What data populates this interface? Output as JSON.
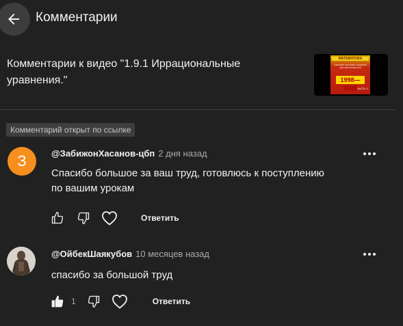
{
  "header": {
    "title": "Комментарии"
  },
  "video": {
    "context_line1": "Комментарии к видео \"1.9.1 Иррациональные",
    "context_line2": "уравнения.\"",
    "thumbnail": {
      "top_text": "МАТЕМАТИКА",
      "mid_text": "СБОРНИК ТЕСТОВЫХ ЗАДАНИЙ ДЛЯ АБИТУРИЕНТОВ",
      "years": "1998—2005",
      "part": "ЧАСТЬ 1"
    }
  },
  "badge": {
    "label": "Комментарий открыт по ссылке"
  },
  "comments": [
    {
      "avatar_letter": "З",
      "avatar_color": "#f68f1e",
      "author": "@ЗабижонХасанов-цбп",
      "time": "2 дня назад",
      "text_line1": "Спасибо большое за ваш труд, готовлюсь к поступлению",
      "text_line2": "по вашим урокам",
      "like_count": "",
      "reply_label": "Ответить"
    },
    {
      "avatar_letter": "",
      "author": "@ОйбекШаякубов",
      "time": "10 месяцев назад",
      "text_line1": "спасибо за большой труд",
      "text_line2": "",
      "like_count": "1",
      "reply_label": "Ответить"
    }
  ],
  "icons": {
    "back": "arrow-left-icon",
    "more": "more-horizontal-icon",
    "like": "thumb-up-icon",
    "dislike": "thumb-down-icon",
    "heart": "heart-icon"
  }
}
